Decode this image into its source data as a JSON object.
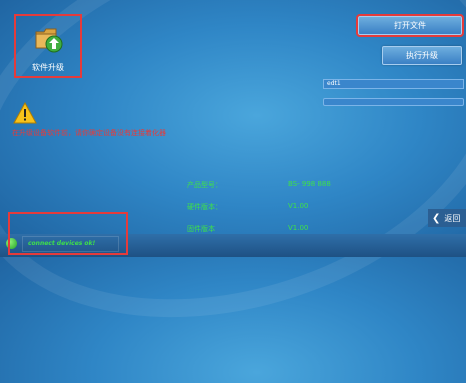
{
  "upgrade_tile": {
    "label": "软件升级",
    "icon": "upload-folder-icon"
  },
  "buttons": {
    "open_file": "打开文件",
    "execute_upgrade": "执行升级",
    "back": "返回"
  },
  "file_path": {
    "value": "edt1"
  },
  "progress": {
    "fraction": 0.0
  },
  "warning": {
    "icon": "warning-icon",
    "text": "在升级设备软件前，请你确定设备没有连接着化器"
  },
  "info": {
    "product_label": "产品型号：",
    "product_value": "BS- 998 888",
    "hardware_label": "硬件版本：",
    "hardware_value": "V1.00",
    "firmware_label": "固件版本",
    "firmware_value": "V1.00"
  },
  "status": {
    "text": "connect devices ok!",
    "color": "#3ee04a"
  },
  "colors": {
    "highlight": "#e53b3b",
    "accent_green": "#3ee04a"
  }
}
